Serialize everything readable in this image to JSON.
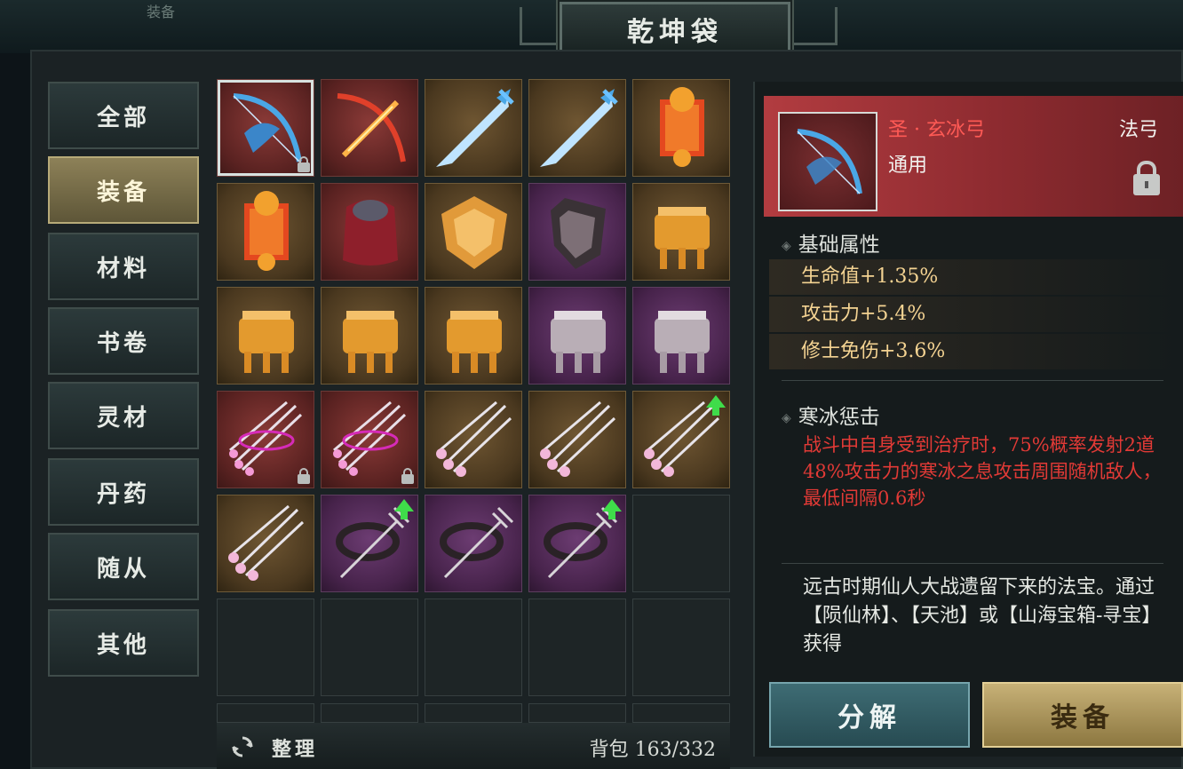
{
  "header": {
    "title": "乾坤袋",
    "bg_text": "装备"
  },
  "categories": [
    {
      "label": "全部",
      "active": false
    },
    {
      "label": "装备",
      "active": true
    },
    {
      "label": "材料",
      "active": false
    },
    {
      "label": "书卷",
      "active": false
    },
    {
      "label": "灵材",
      "active": false
    },
    {
      "label": "丹药",
      "active": false
    },
    {
      "label": "随从",
      "active": false
    },
    {
      "label": "其他",
      "active": false
    }
  ],
  "grid": {
    "slots": [
      {
        "item": "ice-bow-icon",
        "rarity": "red",
        "locked": true,
        "upgrade": false,
        "selected": true
      },
      {
        "item": "fire-bow-icon",
        "rarity": "red",
        "locked": false,
        "upgrade": false
      },
      {
        "item": "ice-sword-icon",
        "rarity": "gold",
        "locked": false,
        "upgrade": false
      },
      {
        "item": "ice-sword-icon",
        "rarity": "gold",
        "locked": false,
        "upgrade": false
      },
      {
        "item": "fire-banner-icon",
        "rarity": "gold",
        "locked": false,
        "upgrade": false
      },
      {
        "item": "fire-banner-icon",
        "rarity": "gold",
        "locked": false,
        "upgrade": false
      },
      {
        "item": "red-bag-icon",
        "rarity": "red",
        "locked": false,
        "upgrade": false
      },
      {
        "item": "gold-shield-icon",
        "rarity": "gold",
        "locked": false,
        "upgrade": false
      },
      {
        "item": "dark-shield-icon",
        "rarity": "purple",
        "locked": false,
        "upgrade": false
      },
      {
        "item": "gold-cauldron-icon",
        "rarity": "gold",
        "locked": false,
        "upgrade": false
      },
      {
        "item": "gold-cauldron-icon",
        "rarity": "gold",
        "locked": false,
        "upgrade": false
      },
      {
        "item": "gold-cauldron-icon",
        "rarity": "gold",
        "locked": false,
        "upgrade": false
      },
      {
        "item": "gold-cauldron-icon",
        "rarity": "gold",
        "locked": false,
        "upgrade": false
      },
      {
        "item": "silver-cauldron-icon",
        "rarity": "purple",
        "locked": false,
        "upgrade": false
      },
      {
        "item": "silver-cauldron-icon",
        "rarity": "purple",
        "locked": false,
        "upgrade": false
      },
      {
        "item": "pink-needles-icon",
        "rarity": "red",
        "locked": true,
        "upgrade": false
      },
      {
        "item": "pink-needles-icon",
        "rarity": "red",
        "locked": true,
        "upgrade": false
      },
      {
        "item": "lotus-needles-icon",
        "rarity": "gold",
        "locked": false,
        "upgrade": false
      },
      {
        "item": "lotus-needles-icon",
        "rarity": "gold",
        "locked": false,
        "upgrade": false
      },
      {
        "item": "lotus-needles-icon",
        "rarity": "gold",
        "locked": false,
        "upgrade": true
      },
      {
        "item": "lotus-needles-icon",
        "rarity": "gold",
        "locked": false,
        "upgrade": false
      },
      {
        "item": "trident-icon",
        "rarity": "purple",
        "locked": false,
        "upgrade": true
      },
      {
        "item": "trident-icon",
        "rarity": "purple",
        "locked": false,
        "upgrade": false
      },
      {
        "item": "trident-icon",
        "rarity": "purple",
        "locked": false,
        "upgrade": true
      },
      {
        "item": "",
        "rarity": "empty"
      },
      {
        "item": "",
        "rarity": "empty"
      },
      {
        "item": "",
        "rarity": "empty"
      },
      {
        "item": "",
        "rarity": "empty"
      },
      {
        "item": "",
        "rarity": "empty"
      },
      {
        "item": "",
        "rarity": "empty"
      }
    ]
  },
  "bottom_bar": {
    "sort_label": "整理",
    "bag_label": "背包 163/332"
  },
  "detail": {
    "name": "圣 · 玄冰弓",
    "class": "法弓",
    "type": "通用",
    "base_title": "基础属性",
    "attributes": [
      "生命值+1.35%",
      "攻击力+5.4%",
      "修士免伤+3.6%"
    ],
    "skill_title": "寒冰惩击",
    "skill_desc": "战斗中自身受到治疗时，75%概率发射2道48%攻击力的寒冰之息攻击周围随机敌人，最低间隔0.6秒",
    "lore": "远古时期仙人大战遗留下来的法宝。通过【陨仙林】、【天池】或【山海宝箱-寻宝】获得"
  },
  "buttons": {
    "decompose": "分解",
    "equip": "装备"
  },
  "colors": {
    "accent_red": "#e23a36",
    "attr_gold": "#f4d392",
    "name_red": "#ff5a55"
  }
}
